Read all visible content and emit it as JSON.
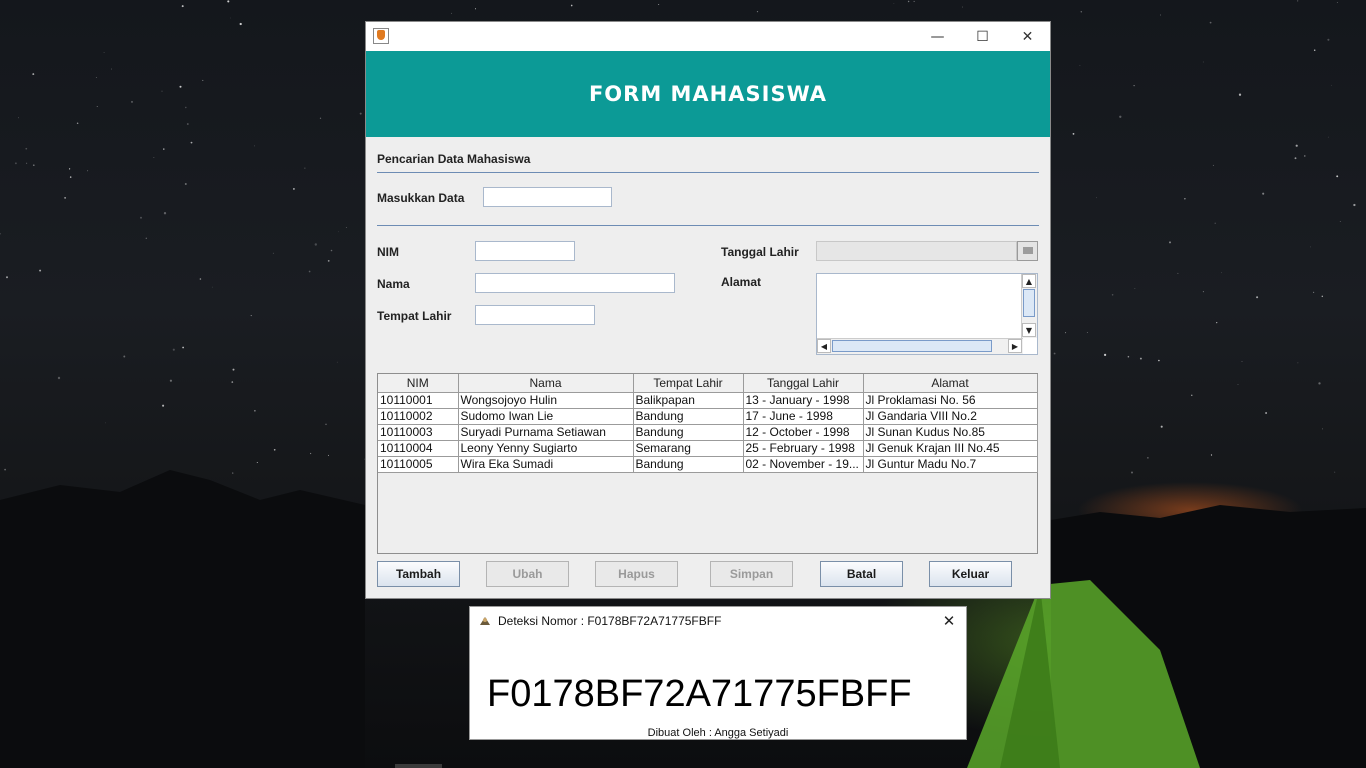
{
  "window": {
    "icon": "java-cup-icon",
    "controls": {
      "minimize": "—",
      "maximize": "☐",
      "close": "✕"
    },
    "banner_title": "FORM MAHASISWA",
    "banner_color": "#0c9a96"
  },
  "search": {
    "section_title": "Pencarian Data Mahasiswa",
    "label": "Masukkan Data",
    "value": ""
  },
  "form": {
    "nim_label": "NIM",
    "nim_value": "",
    "nama_label": "Nama",
    "nama_value": "",
    "tempat_label": "Tempat Lahir",
    "tempat_value": "",
    "tanggal_label": "Tanggal Lahir",
    "tanggal_value": "",
    "alamat_label": "Alamat",
    "alamat_value": ""
  },
  "table": {
    "columns": [
      "NIM",
      "Nama",
      "Tempat Lahir",
      "Tanggal Lahir",
      "Alamat"
    ],
    "rows": [
      [
        "10110001",
        "Wongsojoyo Hulin",
        "Balikpapan",
        "13 - January - 1998",
        "Jl Proklamasi No. 56"
      ],
      [
        "10110002",
        "Sudomo Iwan Lie",
        "Bandung",
        "17 - June - 1998",
        "Jl Gandaria VIII No.2"
      ],
      [
        "10110003",
        "Suryadi Purnama Setiawan",
        "Bandung",
        "12 - October - 1998",
        "Jl Sunan Kudus No.85"
      ],
      [
        "10110004",
        "Leony Yenny Sugiarto",
        "Semarang",
        "25 - February - 1998",
        "Jl Genuk Krajan III No.45"
      ],
      [
        "10110005",
        "Wira Eka Sumadi",
        "Bandung",
        "02 - November - 19...",
        "Jl Guntur Madu No.7"
      ]
    ]
  },
  "buttons": {
    "tambah": "Tambah",
    "ubah": "Ubah",
    "hapus": "Hapus",
    "simpan": "Simpan",
    "batal": "Batal",
    "keluar": "Keluar"
  },
  "dialog": {
    "title": "Deteksi Nomor : F0178BF72A71775FBFF",
    "close": "✕",
    "value": "F0178BF72A71775FBFF",
    "footer": "Dibuat Oleh : Angga Setiyadi"
  }
}
